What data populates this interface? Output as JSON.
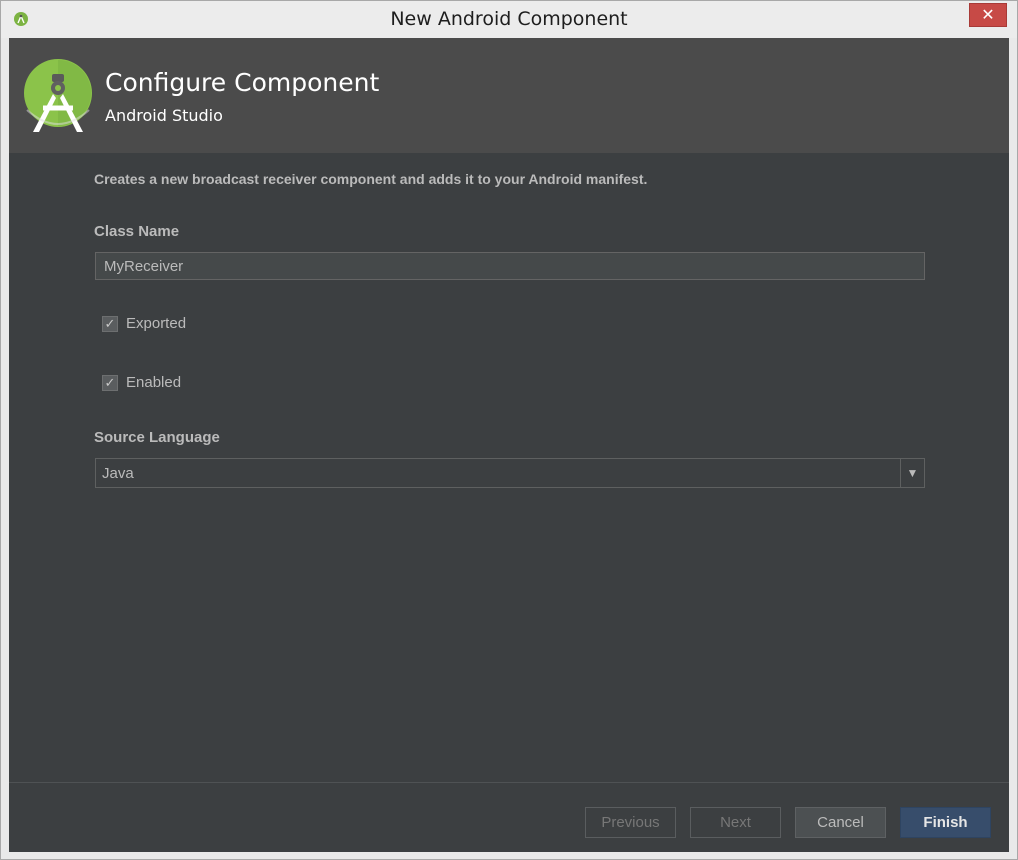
{
  "window": {
    "title": "New Android Component",
    "close_glyph": "✕",
    "icon": "android-studio-icon"
  },
  "header": {
    "title": "Configure Component",
    "subtitle": "Android Studio",
    "logo": "android-studio-logo"
  },
  "form": {
    "description": "Creates a new broadcast receiver component and adds it to your Android manifest.",
    "class_name": {
      "label": "Class Name",
      "value": "MyReceiver"
    },
    "exported": {
      "label": "Exported",
      "checked": true
    },
    "enabled": {
      "label": "Enabled",
      "checked": true
    },
    "source_language": {
      "label": "Source Language",
      "selected": "Java"
    },
    "check_glyph": "✓",
    "dropdown_glyph": "▼"
  },
  "buttons": {
    "previous": "Previous",
    "next": "Next",
    "cancel": "Cancel",
    "finish": "Finish"
  },
  "colors": {
    "background": "#3c3f41",
    "header_background": "#4b4b4b",
    "default_button": "#374d6b",
    "android_green": "#8bc34a"
  }
}
